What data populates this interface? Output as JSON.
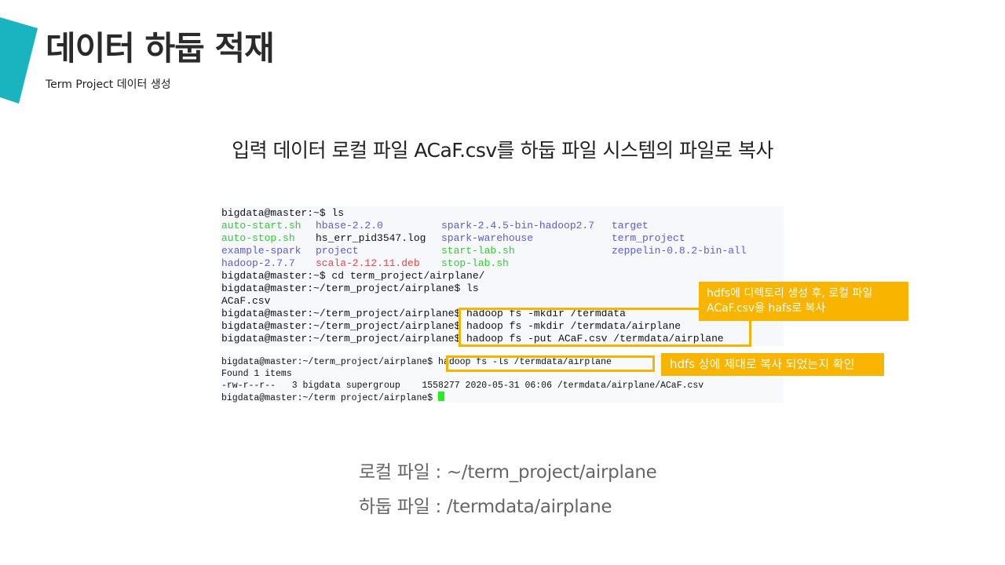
{
  "slide": {
    "title": "데이터 하둡 적재",
    "subtitle": "Term Project 데이터 생성",
    "headline": "입력 데이터 로컬 파일 ACaF.csv를 하둡 파일 시스템의 파일로 복사",
    "accent_color": "#1ab4c0",
    "highlight_color": "#f5b400"
  },
  "terminal1": {
    "prompt_ls": "bigdata@master:~$ ls",
    "ls_rows": [
      [
        {
          "text": "auto-start.sh",
          "color": "green"
        },
        {
          "text": "hbase-2.2.0",
          "color": "blue"
        },
        {
          "text": "spark-2.4.5-bin-hadoop2.7",
          "color": "blue"
        },
        {
          "text": "target",
          "color": "blue"
        }
      ],
      [
        {
          "text": "auto-stop.sh",
          "color": "green"
        },
        {
          "text": "hs_err_pid3547.log",
          "color": "dark"
        },
        {
          "text": "spark-warehouse",
          "color": "blue"
        },
        {
          "text": "term_project",
          "color": "blue"
        }
      ],
      [
        {
          "text": "example-spark",
          "color": "blue"
        },
        {
          "text": "project",
          "color": "blue"
        },
        {
          "text": "start-lab.sh",
          "color": "green"
        },
        {
          "text": "zeppelin-0.8.2-bin-all",
          "color": "blue"
        }
      ],
      [
        {
          "text": "hadoop-2.7.7",
          "color": "blue"
        },
        {
          "text": "scala-2.12.11.deb",
          "color": "red"
        },
        {
          "text": "stop-lab.sh",
          "color": "green"
        },
        {
          "text": "",
          "color": "dark"
        }
      ]
    ],
    "cd_line": "bigdata@master:~$ cd term_project/airplane/",
    "ls2_line": "bigdata@master:~/term_project/airplane$ ls",
    "file_line": "ACaF.csv",
    "cmd_lines": [
      "bigdata@master:~/term_project/airplane$ hadoop fs -mkdir /termdata",
      "bigdata@master:~/term_project/airplane$ hadoop fs -mkdir /termdata/airplane",
      "bigdata@master:~/term_project/airplane$ hadoop fs -put ACaF.csv /termdata/airplane"
    ]
  },
  "terminal2": {
    "lines": [
      "bigdata@master:~/term_project/airplane$ hadoop fs -ls /termdata/airplane",
      "Found 1 items",
      "-rw-r--r--   3 bigdata supergroup    1558277 2020-05-31 06:06 /termdata/airplane/ACaF.csv",
      "bigdata@master:~/term project/airplane$ "
    ]
  },
  "callouts": {
    "mkdir_put_line1": "hdfs에 디렉토리 생성 후, 로컬 파일",
    "mkdir_put_line2": "ACaF.csv을 hafs로 복사",
    "verify": "hdfs 상에  제대로 복사 되었는지 확인"
  },
  "paths": {
    "local": "로컬 파일 : ~/term_project/airplane",
    "hadoop": "하둡 파일 : /termdata/airplane"
  }
}
